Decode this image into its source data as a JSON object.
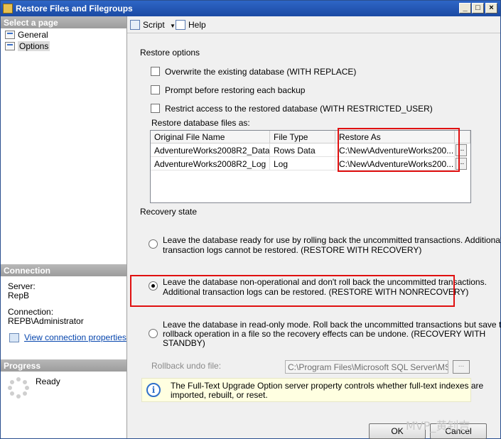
{
  "window": {
    "title": "Restore Files and Filegroups"
  },
  "left": {
    "select_page": "Select a page",
    "pages": [
      {
        "label": "General",
        "icon": "page-icon"
      },
      {
        "label": "Options",
        "icon": "page-icon",
        "selected": true
      }
    ],
    "connection_header": "Connection",
    "server_label": "Server:",
    "server_value": "RepB",
    "connection_label": "Connection:",
    "connection_value": "REPB\\Administrator",
    "view_props_link": "View connection properties",
    "progress_header": "Progress",
    "progress_status": "Ready"
  },
  "toolbar": {
    "script_label": "Script",
    "help_label": "Help"
  },
  "options": {
    "restore_options_label": "Restore options",
    "checkboxes": [
      "Overwrite the existing database (WITH REPLACE)",
      "Prompt before restoring each backup",
      "Restrict access to the restored database (WITH RESTRICTED_USER)"
    ],
    "files_label": "Restore database files as:",
    "grid": {
      "columns": [
        "Original File Name",
        "File Type",
        "Restore As"
      ],
      "rows": [
        [
          "AdventureWorks2008R2_Data",
          "Rows Data",
          "C:\\New\\AdventureWorks200..."
        ],
        [
          "AdventureWorks2008R2_Log",
          "Log",
          "C:\\New\\AdventureWorks200..."
        ]
      ],
      "browse_label": "..."
    },
    "recovery_label": "Recovery state",
    "recovery_options": [
      {
        "line1": "Leave the database ready for use by rolling back the uncommitted transactions. Additional",
        "line2": "transaction logs cannot be restored. (RESTORE WITH RECOVERY)",
        "line3": "",
        "checked": false
      },
      {
        "line1": "Leave the database non-operational and don't roll back the uncommitted transactions.",
        "line2": "Additional transaction logs can be restored. (RESTORE WITH NONRECOVERY)",
        "line3": "",
        "checked": true
      },
      {
        "line1": "Leave the database in read-only mode. Roll back the uncommitted transactions but save the",
        "line2": "rollback operation in a file so the recovery effects can be undone. (RECOVERY WITH",
        "line3": "STANDBY)",
        "checked": false
      }
    ],
    "rollback_label": "Rollback undo file:",
    "rollback_value": "C:\\Program Files\\Microsoft SQL Server\\MSSQL",
    "info_line1": "The Full-Text Upgrade Option server property controls whether full-text indexes are",
    "info_line2": "imported, rebuilt, or reset."
  },
  "buttons": {
    "ok": "OK",
    "cancel": "Cancel"
  },
  "watermark": "MVP_黄钊吉",
  "colors": {
    "highlight_box": "#e01010",
    "title_bar": "#2e66c6"
  }
}
